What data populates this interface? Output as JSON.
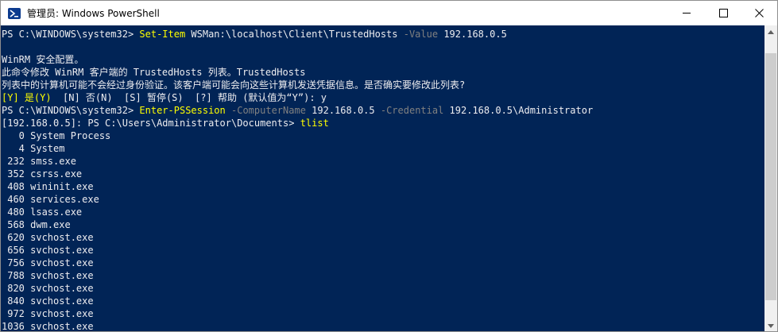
{
  "window": {
    "title": "管理员: Windows PowerShell"
  },
  "console": {
    "l1": {
      "prompt": "PS C:\\WINDOWS\\system32> ",
      "cmd": "Set-Item",
      "rest1": " WSMan:\\localhost\\Client\\TrustedHosts ",
      "param": "-Value",
      "rest2": " 192.168.0.5"
    },
    "l2": "WinRM 安全配置。",
    "l3": "此命令修改 WinRM 客户端的 TrustedHosts 列表。TrustedHosts",
    "l4": "列表中的计算机可能不会经过身份验证。该客户端可能会向这些计算机发送凭据信息。是否确实要修改此列表?",
    "l5": {
      "yes": "[Y] 是(Y)",
      "rest": "  [N] 否(N)  [S] 暂停(S)  [?] 帮助 (默认值为“Y”): y"
    },
    "l6": {
      "prompt": "PS C:\\WINDOWS\\system32> ",
      "cmd": "Enter-PSSession",
      "sp1": " ",
      "param1": "-ComputerName",
      "val1": " 192.168.0.5 ",
      "param2": "-Credential",
      "val2": " 192.168.0.5\\Administrator"
    },
    "l7": {
      "prompt": "[192.168.0.5]: PS C:\\Users\\Administrator\\Documents> ",
      "cmd": "tlist"
    },
    "processes": [
      "   0 System Process",
      "   4 System",
      " 232 smss.exe",
      " 352 csrss.exe",
      " 408 wininit.exe",
      " 460 services.exe",
      " 480 lsass.exe",
      " 568 dwm.exe",
      " 620 svchost.exe",
      " 656 svchost.exe",
      " 756 svchost.exe",
      " 788 svchost.exe",
      " 820 svchost.exe",
      " 840 svchost.exe",
      " 972 svchost.exe",
      "1036 svchost.exe"
    ]
  }
}
